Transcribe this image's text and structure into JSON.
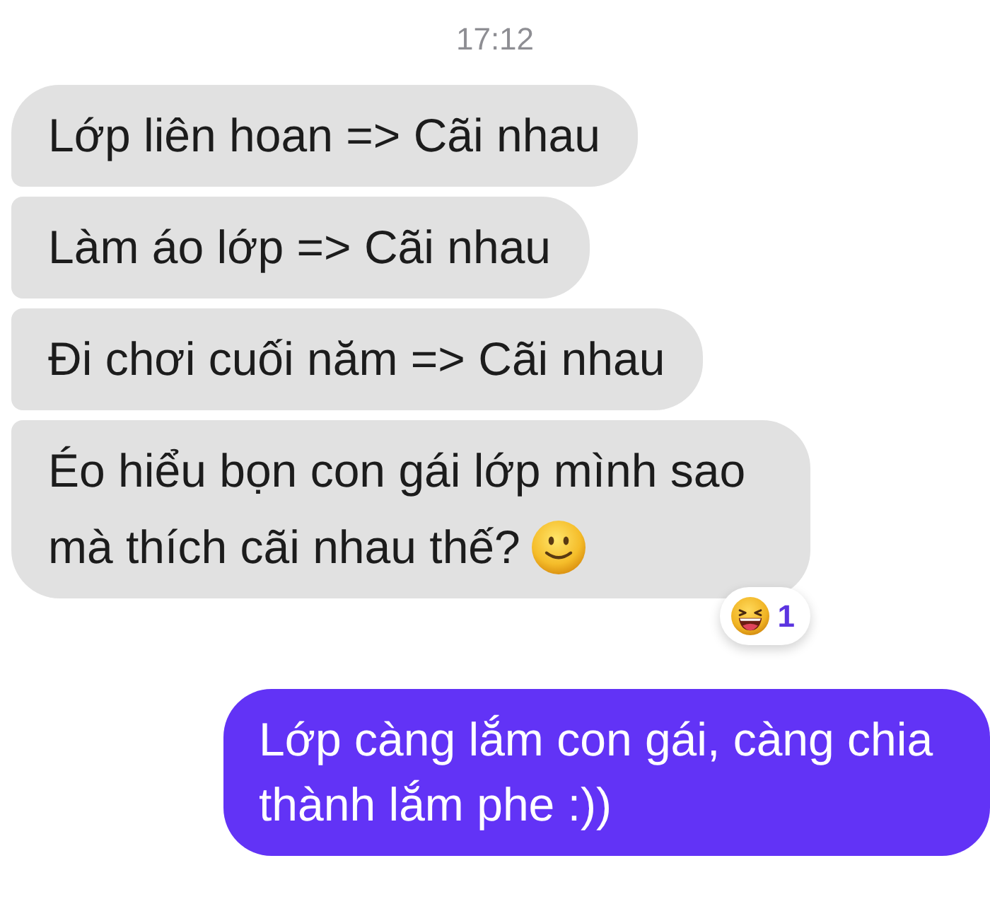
{
  "timestamp": "17:12",
  "messages": [
    {
      "kind": "incoming",
      "text": "Lớp liên hoan => Cãi nhau",
      "emoji": false
    },
    {
      "kind": "incoming",
      "text": "Làm áo lớp => Cãi nhau",
      "emoji": false
    },
    {
      "kind": "incoming",
      "text": "Đi chơi cuối năm => Cãi nhau",
      "emoji": false
    },
    {
      "kind": "incoming",
      "text": "Éo hiểu bọn con gái lớp mình sao mà thích cãi nhau thế?",
      "emoji": true,
      "reaction": {
        "count": "1"
      }
    },
    {
      "kind": "outgoing",
      "text": "Lớp càng lắm con gái, càng chia thành lắm phe :))",
      "emoji": false
    }
  ]
}
